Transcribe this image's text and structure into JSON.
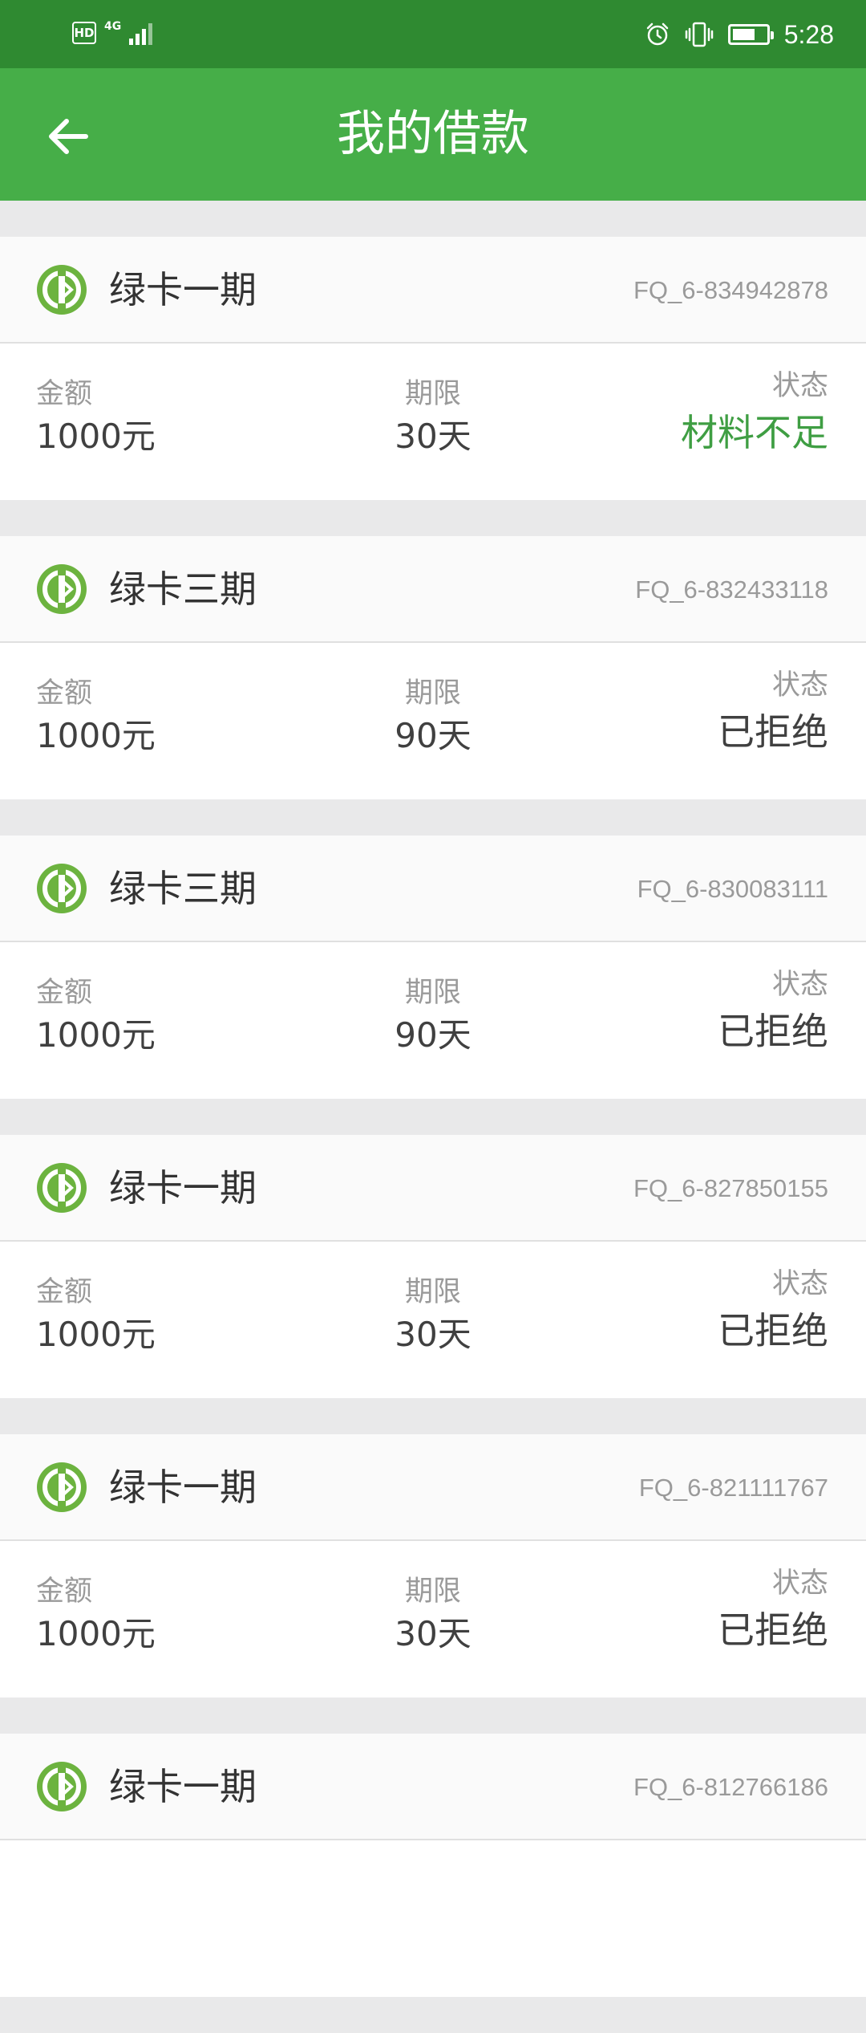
{
  "status_bar": {
    "network_badge": "HD",
    "network_type": "4G",
    "time": "5:28"
  },
  "header": {
    "title": "我的借款"
  },
  "labels": {
    "amount": "金额",
    "term": "期限",
    "status": "状态"
  },
  "colors": {
    "header_green": "#46ae48",
    "status_bar_green": "#2f8a31",
    "accent_green": "#3f9e43"
  },
  "loans": [
    {
      "product": "绿卡一期",
      "order_no": "FQ_6-834942878",
      "amount": "1000元",
      "term": "30天",
      "status": "材料不足",
      "status_color": "#3f9e43"
    },
    {
      "product": "绿卡三期",
      "order_no": "FQ_6-832433118",
      "amount": "1000元",
      "term": "90天",
      "status": "已拒绝",
      "status_color": "#404040"
    },
    {
      "product": "绿卡三期",
      "order_no": "FQ_6-830083111",
      "amount": "1000元",
      "term": "90天",
      "status": "已拒绝",
      "status_color": "#404040"
    },
    {
      "product": "绿卡一期",
      "order_no": "FQ_6-827850155",
      "amount": "1000元",
      "term": "30天",
      "status": "已拒绝",
      "status_color": "#404040"
    },
    {
      "product": "绿卡一期",
      "order_no": "FQ_6-821111767",
      "amount": "1000元",
      "term": "30天",
      "status": "已拒绝",
      "status_color": "#404040"
    },
    {
      "product": "绿卡一期",
      "order_no": "FQ_6-812766186"
    }
  ]
}
